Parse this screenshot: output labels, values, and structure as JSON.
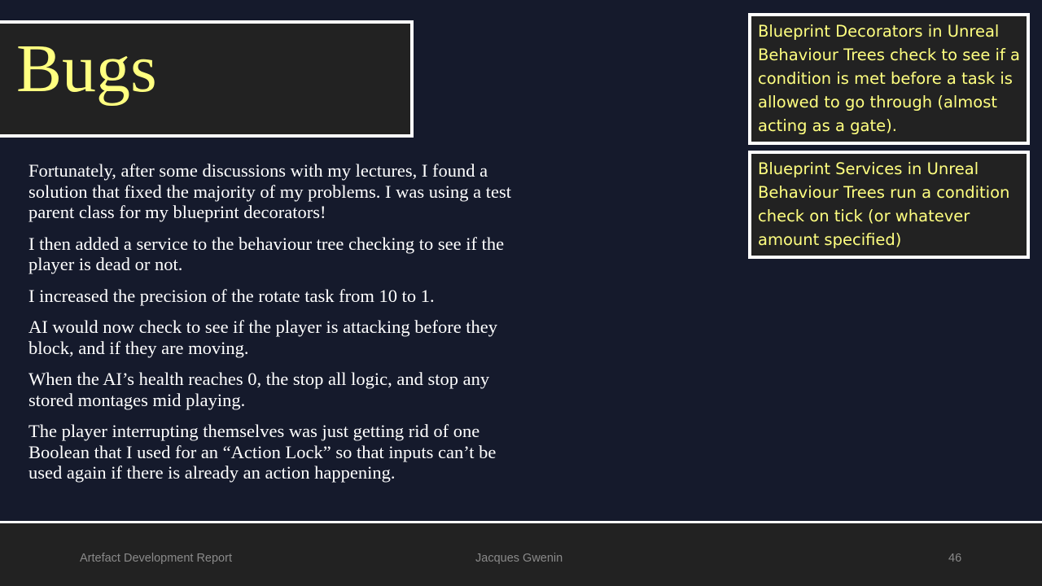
{
  "slide": {
    "title": "Bugs",
    "paragraphs": [
      "Fortunately, after some discussions with my lectures, I found a solution that fixed the majority of my problems. I was using a test parent class for my blueprint decorators!",
      "I then added a service to the behaviour tree checking to see if the player is dead or not.",
      "I increased the precision of the rotate task from 10 to 1.",
      "AI would now check to see if the player is attacking before they block, and if they are moving.",
      "When the AI’s health reaches 0, the stop all logic, and stop any stored montages mid playing.",
      "The player interrupting themselves was just getting rid of one Boolean that I used for an “Action Lock” so that inputs can’t be used again if there is already an action happening."
    ],
    "notes": [
      "Blueprint Decorators in Unreal Behaviour Trees check to see if a condition is met before a task is allowed to go through (almost acting as a gate).",
      "Blueprint Services in Unreal Behaviour Trees run a condition check on tick (or whatever amount specified)"
    ]
  },
  "footer": {
    "left": "Artefact Development Report",
    "center": "Jacques Gwenin",
    "page_number": "46"
  },
  "colors": {
    "background": "#151a2c",
    "box_fill": "#222222",
    "accent_yellow": "#ffff80",
    "border": "#ffffff",
    "footer_text": "#8a8a8a"
  }
}
